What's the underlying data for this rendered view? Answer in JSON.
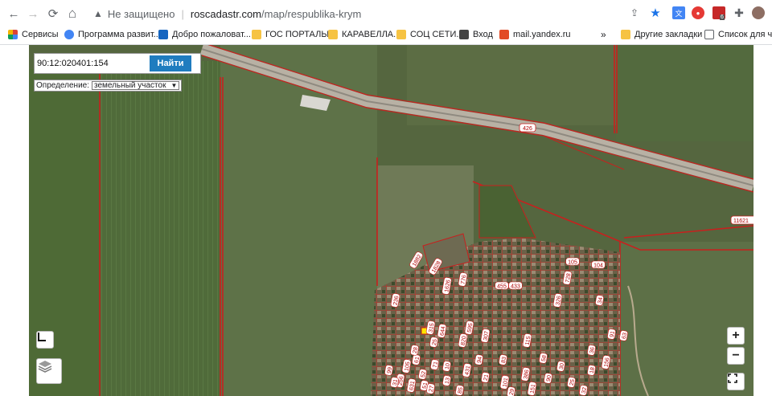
{
  "browser": {
    "nav": {
      "back": "←",
      "forward": "→",
      "reload": "⟳",
      "home": "⌂"
    },
    "address": {
      "security_label": "Не защищено",
      "separator": "|",
      "host": "roscadastr.com",
      "path": "/map/respublika-krym"
    },
    "extension_badge": "6",
    "bookmarks": [
      {
        "label": "Сервисы",
        "color": "#db4437"
      },
      {
        "label": "Программа развит...",
        "color": "#4285f4"
      },
      {
        "label": "Добро пожаловат...",
        "color": "#1565c0"
      },
      {
        "label": "ГОС ПОРТАЛЫ.",
        "color": "#f6c343"
      },
      {
        "label": "КАРАВЕЛЛА.",
        "color": "#f6c343"
      },
      {
        "label": "СОЦ СЕТИ.",
        "color": "#f6c343"
      },
      {
        "label": "Вход",
        "color": "#444444"
      },
      {
        "label": "mail.yandex.ru",
        "color": "#e24b26"
      },
      {
        "label": "»",
        "color": ""
      },
      {
        "label": "Другие закладки",
        "color": "#f6c343"
      },
      {
        "label": "Список для чтения",
        "color": "#5f6368"
      }
    ]
  },
  "map": {
    "search": {
      "value": "90:12:020401:154",
      "placeholder": "",
      "button_label": "Найти"
    },
    "definition": {
      "label": "Определение:",
      "selected": "земельный участок"
    },
    "zoom_in": "+",
    "zoom_out": "−",
    "road_label": "426",
    "edge_label": "11621",
    "parcels": [
      "1882",
      "1828",
      "1626",
      "776",
      "105",
      "104",
      "728",
      "455",
      "433",
      "236",
      "315",
      "644",
      "25",
      "820",
      "595",
      "307",
      "326",
      "34",
      "431",
      "13",
      "71",
      "52",
      "115",
      "105",
      "61",
      "256",
      "631",
      "51",
      "27",
      "10",
      "99",
      "31",
      "28",
      "94",
      "21",
      "83",
      "101",
      "386",
      "58",
      "30",
      "25",
      "18",
      "91",
      "156",
      "63",
      "36",
      "32",
      "29",
      "151",
      "90",
      "85"
    ]
  }
}
